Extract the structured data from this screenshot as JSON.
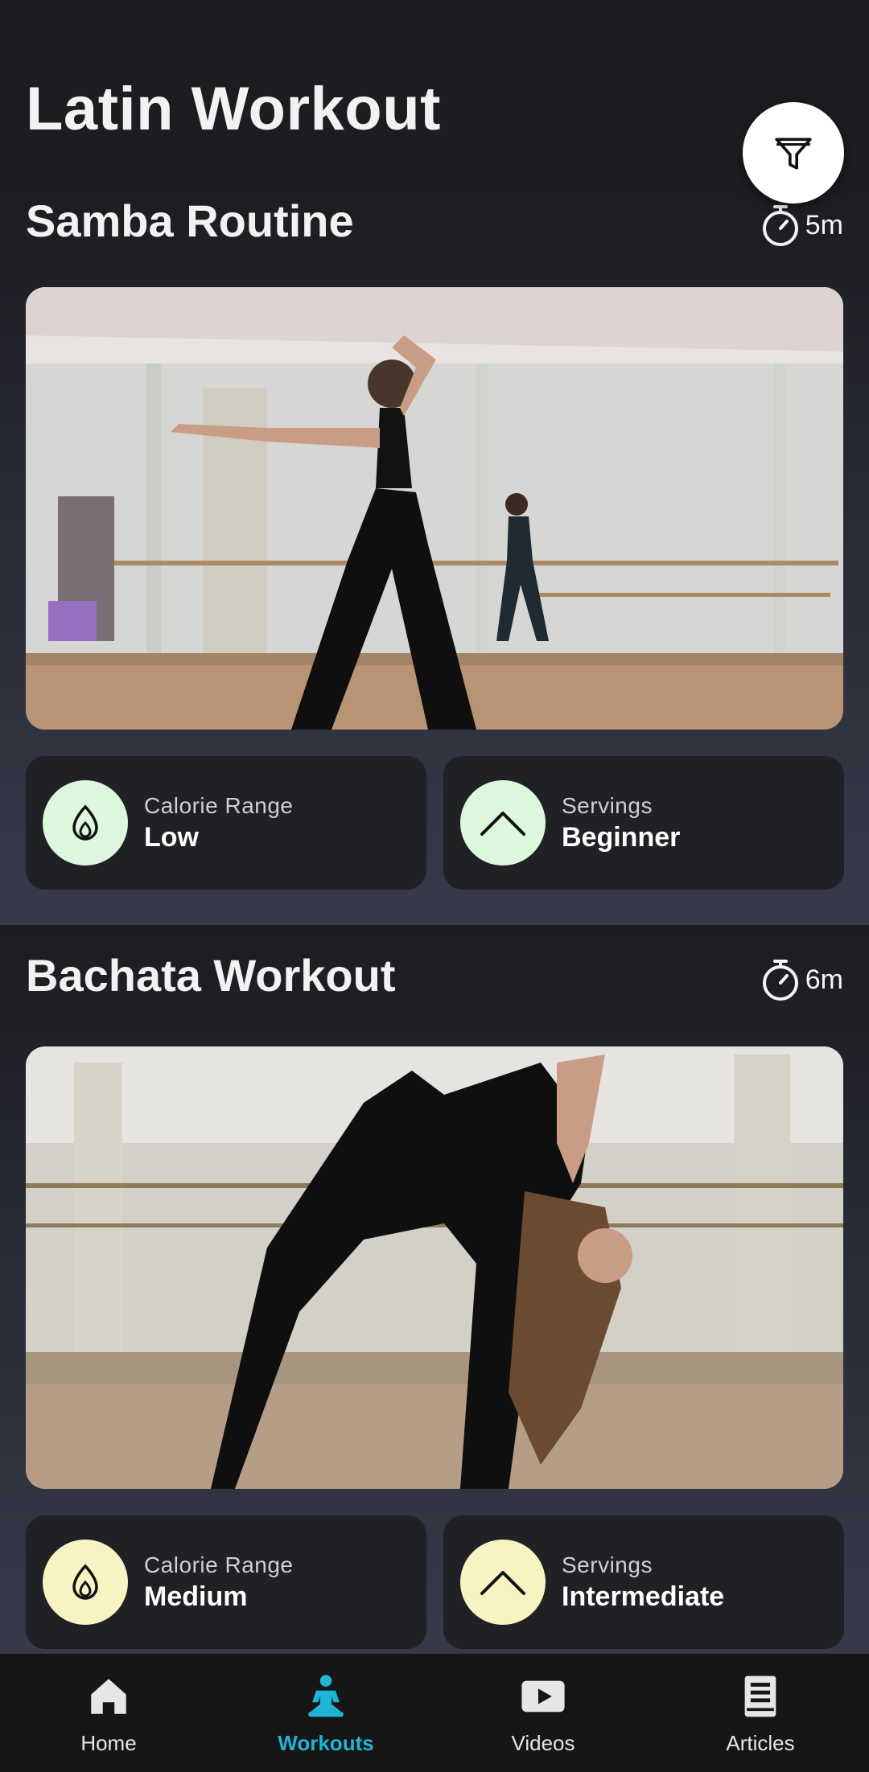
{
  "header": {
    "title": "Latin Workout",
    "filter_icon": "filter-icon"
  },
  "workouts": [
    {
      "title": "Samba Routine",
      "duration": "5m",
      "image": "dancer-stretch-studio-photo",
      "calorie": {
        "label": "Calorie Range",
        "value": "Low",
        "icon": "flame-icon",
        "color": "#dcf7dc"
      },
      "level": {
        "label": "Servings",
        "value": "Beginner",
        "icon": "chevron-up-icon",
        "color": "#dcf7dc"
      }
    },
    {
      "title": "Bachata Workout",
      "duration": "6m",
      "image": "dancer-backbend-studio-photo",
      "calorie": {
        "label": "Calorie Range",
        "value": "Medium",
        "icon": "flame-icon",
        "color": "#f8f3c2"
      },
      "level": {
        "label": "Servings",
        "value": "Intermediate",
        "icon": "chevron-up-icon",
        "color": "#f8f3c2"
      }
    }
  ],
  "nav": {
    "items": [
      {
        "label": "Home",
        "icon": "home-icon"
      },
      {
        "label": "Workouts",
        "icon": "workout-person-icon",
        "active": true
      },
      {
        "label": "Videos",
        "icon": "play-video-icon"
      },
      {
        "label": "Articles",
        "icon": "book-icon"
      }
    ],
    "active_color": "#1fb6d5"
  }
}
